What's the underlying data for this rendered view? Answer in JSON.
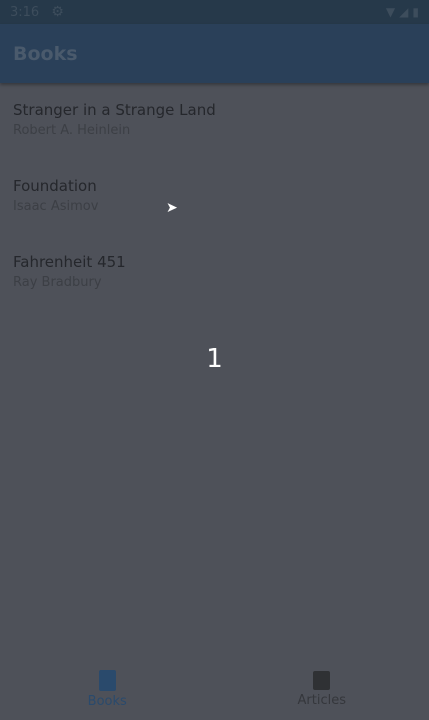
{
  "status_bar": {
    "time": "3:16"
  },
  "app_bar": {
    "title": "Books"
  },
  "books": [
    {
      "title": "Stranger in a Strange Land",
      "author": "Robert A. Heinlein"
    },
    {
      "title": "Foundation",
      "author": "Isaac Asimov"
    },
    {
      "title": "Fahrenheit 451",
      "author": "Ray Bradbury"
    }
  ],
  "overlay": {
    "text": "1"
  },
  "bottom_nav": {
    "items": [
      {
        "label": "Books",
        "icon": "book-icon",
        "selected": true
      },
      {
        "label": "Articles",
        "icon": "article-icon",
        "selected": false
      }
    ]
  },
  "colors": {
    "primary": "#2a4059",
    "overlay": "#4e5159"
  }
}
